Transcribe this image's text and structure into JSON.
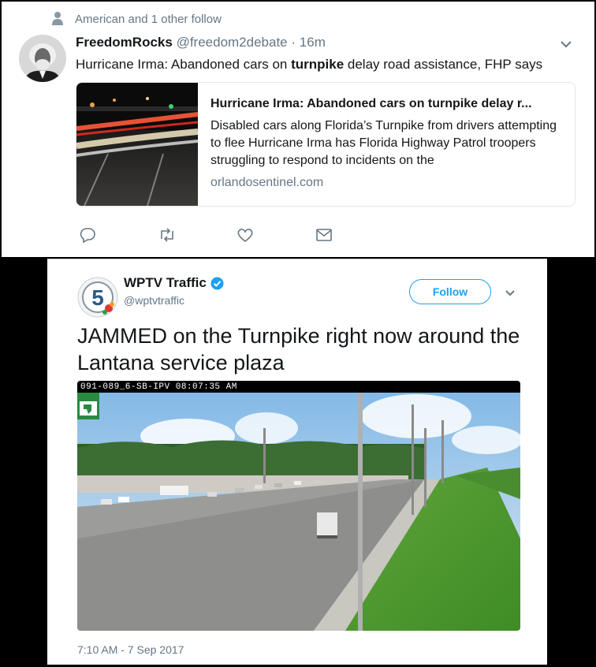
{
  "tweet1": {
    "social_context": "American and 1 other follow",
    "author_name": "FreedomRocks",
    "handle": "@freedom2debate",
    "separator": "·",
    "time": "16m",
    "text_before": "Hurricane Irma: Abandoned cars on ",
    "text_bold": "turnpike",
    "text_after": " delay road assistance, FHP says",
    "card": {
      "title": "Hurricane Irma: Abandoned cars on turnpike delay r...",
      "description": "Disabled cars along Florida’s Turnpike from drivers attempting to flee Hurricane Irma has Florida Highway Patrol troopers struggling to respond to incidents on the",
      "domain": "orlandosentinel.com"
    },
    "actions": [
      "reply-icon",
      "retweet-icon",
      "like-icon",
      "message-icon"
    ]
  },
  "tweet2": {
    "author_name": "WPTV Traffic",
    "handle": "@wptvtraffic",
    "follow_label": "Follow",
    "text": "JAMMED on the Turnpike right now around the Lantana service plaza",
    "camera_overlay": "091-089_6-SB-IPV  08:07:35 AM",
    "timestamp": "7:10 AM - 7 Sep 2017"
  },
  "colors": {
    "accent": "#1da1f2",
    "secondary_text": "#657786",
    "primary_text": "#14171a",
    "border": "#e1e8ed"
  }
}
